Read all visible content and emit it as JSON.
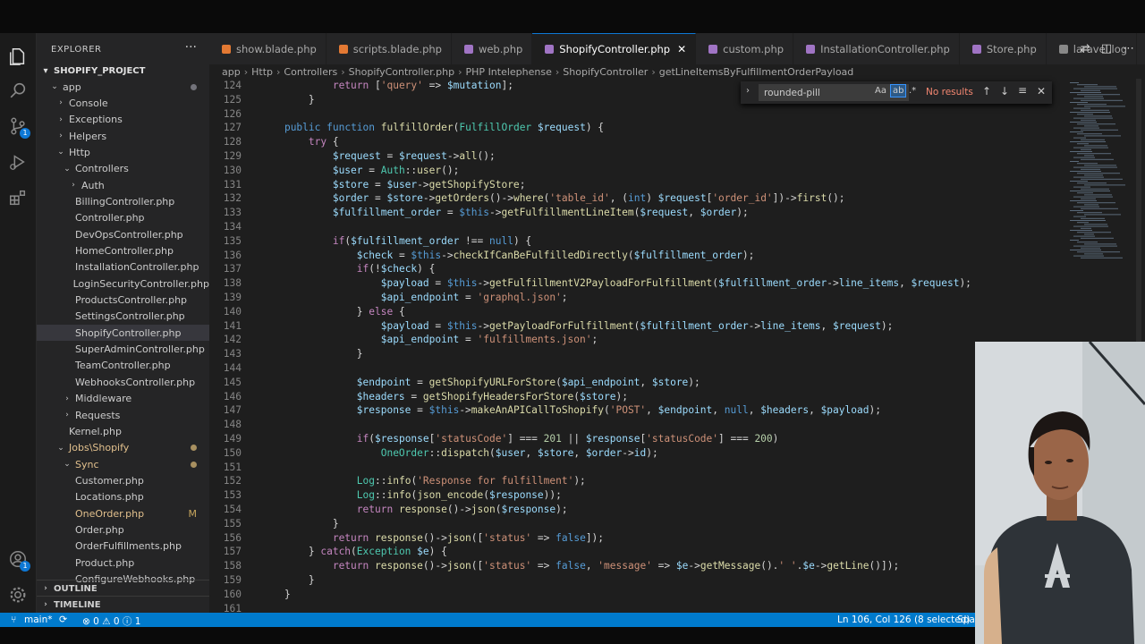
{
  "sidebar": {
    "title": "EXPLORER",
    "more": "···",
    "project": "SHOPIFY_PROJECT",
    "items": [
      {
        "label": "app",
        "depth": 0,
        "kind": "open",
        "dot": true
      },
      {
        "label": "Console",
        "depth": 1,
        "kind": "closed"
      },
      {
        "label": "Exceptions",
        "depth": 1,
        "kind": "closed"
      },
      {
        "label": "Helpers",
        "depth": 1,
        "kind": "closed"
      },
      {
        "label": "Http",
        "depth": 1,
        "kind": "open"
      },
      {
        "label": "Controllers",
        "depth": 2,
        "kind": "open"
      },
      {
        "label": "Auth",
        "depth": 3,
        "kind": "closed"
      },
      {
        "label": "BillingController.php",
        "depth": 3,
        "kind": "file"
      },
      {
        "label": "Controller.php",
        "depth": 3,
        "kind": "file"
      },
      {
        "label": "DevOpsController.php",
        "depth": 3,
        "kind": "file"
      },
      {
        "label": "HomeController.php",
        "depth": 3,
        "kind": "file"
      },
      {
        "label": "InstallationController.php",
        "depth": 3,
        "kind": "file"
      },
      {
        "label": "LoginSecurityController.php",
        "depth": 3,
        "kind": "file"
      },
      {
        "label": "ProductsController.php",
        "depth": 3,
        "kind": "file"
      },
      {
        "label": "SettingsController.php",
        "depth": 3,
        "kind": "file"
      },
      {
        "label": "ShopifyController.php",
        "depth": 3,
        "kind": "file",
        "selected": true
      },
      {
        "label": "SuperAdminController.php",
        "depth": 3,
        "kind": "file"
      },
      {
        "label": "TeamController.php",
        "depth": 3,
        "kind": "file"
      },
      {
        "label": "WebhooksController.php",
        "depth": 3,
        "kind": "file"
      },
      {
        "label": "Middleware",
        "depth": 2,
        "kind": "closed"
      },
      {
        "label": "Requests",
        "depth": 2,
        "kind": "closed"
      },
      {
        "label": "Kernel.php",
        "depth": 2,
        "kind": "file"
      },
      {
        "label": "Jobs\\Shopify",
        "depth": 1,
        "kind": "open",
        "dot": true,
        "color": "#e2c08d"
      },
      {
        "label": "Sync",
        "depth": 2,
        "kind": "open",
        "dot": true,
        "color": "#e2c08d"
      },
      {
        "label": "Customer.php",
        "depth": 3,
        "kind": "file"
      },
      {
        "label": "Locations.php",
        "depth": 3,
        "kind": "file"
      },
      {
        "label": "OneOrder.php",
        "depth": 3,
        "kind": "file",
        "color": "#e2c08d",
        "mod": "M"
      },
      {
        "label": "Order.php",
        "depth": 3,
        "kind": "file"
      },
      {
        "label": "OrderFulfillments.php",
        "depth": 3,
        "kind": "file"
      },
      {
        "label": "Product.php",
        "depth": 3,
        "kind": "file"
      },
      {
        "label": "ConfigureWebhooks.php",
        "depth": 3,
        "kind": "file"
      }
    ],
    "outline": "OUTLINE",
    "timeline": "TIMELINE"
  },
  "tabs": [
    {
      "label": "show.blade.php",
      "icon_color": "#e37933"
    },
    {
      "label": "scripts.blade.php",
      "icon_color": "#e37933"
    },
    {
      "label": "web.php",
      "icon_color": "#a074c4"
    },
    {
      "label": "ShopifyController.php",
      "icon_color": "#a074c4",
      "active": true,
      "close": "✕"
    },
    {
      "label": "custom.php",
      "icon_color": "#a074c4"
    },
    {
      "label": "InstallationController.php",
      "icon_color": "#a074c4"
    },
    {
      "label": "Store.php",
      "icon_color": "#a074c4"
    },
    {
      "label": "laravel.log",
      "icon_color": "#888888"
    }
  ],
  "breadcrumb": [
    "app",
    "Http",
    "Controllers",
    "ShopifyController.php",
    "PHP Intelephense",
    "ShopifyController",
    "getLineItemsByFulfillmentOrderPayload"
  ],
  "find": {
    "query": "rounded-pill",
    "case": "Aa",
    "word": "ab",
    "regex": ".*",
    "result": "No results"
  },
  "code_lines": [
    {
      "n": "124",
      "h": "            <span class=\"c\">return</span> [<span class=\"s\">'query'</span> => <span class=\"v\">$mutation</span>];"
    },
    {
      "n": "125",
      "h": "        }"
    },
    {
      "n": "126",
      "h": ""
    },
    {
      "n": "127",
      "h": "    <span class=\"k\">public</span> <span class=\"k\">function</span> <span class=\"f\">fulfillOrder</span>(<span class=\"t\">FulfillOrder</span> <span class=\"v\">$request</span>) {"
    },
    {
      "n": "128",
      "h": "        <span class=\"c\">try</span> {"
    },
    {
      "n": "129",
      "h": "            <span class=\"v\">$request</span> = <span class=\"v\">$request</span>-><span class=\"f\">all</span>();"
    },
    {
      "n": "130",
      "h": "            <span class=\"v\">$user</span> = <span class=\"t\">Auth</span>::<span class=\"f\">user</span>();"
    },
    {
      "n": "131",
      "h": "            <span class=\"v\">$store</span> = <span class=\"v\">$user</span>-><span class=\"f\">getShopifyStore</span>;"
    },
    {
      "n": "132",
      "h": "            <span class=\"v\">$order</span> = <span class=\"v\">$store</span>-><span class=\"f\">getOrders</span>()-><span class=\"f\">where</span>(<span class=\"s\">'table_id'</span>, (<span class=\"k\">int</span>) <span class=\"v\">$request</span>[<span class=\"s\">'order_id'</span>])-><span class=\"f\">first</span>();"
    },
    {
      "n": "133",
      "h": "            <span class=\"v\">$fulfillment_order</span> = <span class=\"k\">$this</span>-><span class=\"f\">getFulfillmentLineItem</span>(<span class=\"v\">$request</span>, <span class=\"v\">$order</span>);"
    },
    {
      "n": "134",
      "h": ""
    },
    {
      "n": "135",
      "h": "            <span class=\"c\">if</span>(<span class=\"v\">$fulfillment_order</span> !== <span class=\"k\">null</span>) {"
    },
    {
      "n": "136",
      "h": "                <span class=\"v\">$check</span> = <span class=\"k\">$this</span>-><span class=\"f\">checkIfCanBeFulfilledDirectly</span>(<span class=\"v\">$fulfillment_order</span>);"
    },
    {
      "n": "137",
      "h": "                <span class=\"c\">if</span>(!<span class=\"v\">$check</span>) {"
    },
    {
      "n": "138",
      "h": "                    <span class=\"v\">$payload</span> = <span class=\"k\">$this</span>-><span class=\"f\">getFulfillmentV2PayloadForFulfillment</span>(<span class=\"v\">$fulfillment_order</span>-><span class=\"v\">line_items</span>, <span class=\"v\">$request</span>);"
    },
    {
      "n": "139",
      "h": "                    <span class=\"v\">$api_endpoint</span> = <span class=\"s\">'graphql.json'</span>;"
    },
    {
      "n": "140",
      "h": "                } <span class=\"c\">else</span> {"
    },
    {
      "n": "141",
      "h": "                    <span class=\"v\">$payload</span> = <span class=\"k\">$this</span>-><span class=\"f\">getPayloadForFulfillment</span>(<span class=\"v\">$fulfillment_order</span>-><span class=\"v\">line_items</span>, <span class=\"v\">$request</span>);"
    },
    {
      "n": "142",
      "h": "                    <span class=\"v\">$api_endpoint</span> = <span class=\"s\">'fulfillments.json'</span>;"
    },
    {
      "n": "143",
      "h": "                }"
    },
    {
      "n": "144",
      "h": ""
    },
    {
      "n": "145",
      "h": "                <span class=\"v\">$endpoint</span> = <span class=\"f\">getShopifyURLForStore</span>(<span class=\"v\">$api_endpoint</span>, <span class=\"v\">$store</span>);"
    },
    {
      "n": "146",
      "h": "                <span class=\"v\">$headers</span> = <span class=\"f\">getShopifyHeadersForStore</span>(<span class=\"v\">$store</span>);"
    },
    {
      "n": "147",
      "h": "                <span class=\"v\">$response</span> = <span class=\"k\">$this</span>-><span class=\"f\">makeAnAPICallToShopify</span>(<span class=\"s\">'POST'</span>, <span class=\"v\">$endpoint</span>, <span class=\"k\">null</span>, <span class=\"v\">$headers</span>, <span class=\"v\">$payload</span>);"
    },
    {
      "n": "148",
      "h": ""
    },
    {
      "n": "149",
      "h": "                <span class=\"c\">if</span>(<span class=\"v\">$response</span>[<span class=\"s\">'statusCode'</span>] === <span class=\"n\">201</span> || <span class=\"v\">$response</span>[<span class=\"s\">'statusCode'</span>] === <span class=\"n\">200</span>)"
    },
    {
      "n": "150",
      "h": "                    <span class=\"t\">OneOrder</span>::<span class=\"f\">dispatch</span>(<span class=\"v\">$user</span>, <span class=\"v\">$store</span>, <span class=\"v\">$order</span>-><span class=\"v\">id</span>);"
    },
    {
      "n": "151",
      "h": ""
    },
    {
      "n": "152",
      "h": "                <span class=\"t\">Log</span>::<span class=\"f\">info</span>(<span class=\"s\">'Response for fulfillment'</span>);"
    },
    {
      "n": "153",
      "h": "                <span class=\"t\">Log</span>::<span class=\"f\">info</span>(<span class=\"f\">json_encode</span>(<span class=\"v\">$response</span>));"
    },
    {
      "n": "154",
      "h": "                <span class=\"c\">return</span> <span class=\"f\">response</span>()-><span class=\"f\">json</span>(<span class=\"v\">$response</span>);"
    },
    {
      "n": "155",
      "h": "            }"
    },
    {
      "n": "156",
      "h": "            <span class=\"c\">return</span> <span class=\"f\">response</span>()-><span class=\"f\">json</span>([<span class=\"s\">'status'</span> => <span class=\"k\">false</span>]);"
    },
    {
      "n": "157",
      "h": "        } <span class=\"c\">catch</span>(<span class=\"t\">Exception</span> <span class=\"v\">$e</span>) {"
    },
    {
      "n": "158",
      "h": "            <span class=\"c\">return</span> <span class=\"f\">response</span>()-><span class=\"f\">json</span>([<span class=\"s\">'status'</span> => <span class=\"k\">false</span>, <span class=\"s\">'message'</span> => <span class=\"v\">$e</span>-><span class=\"f\">getMessage</span>().<span class=\"s\">' '</span>.<span class=\"v\">$e</span>-><span class=\"f\">getLine</span>()]);"
    },
    {
      "n": "159",
      "h": "        }"
    },
    {
      "n": "160",
      "h": "    }"
    },
    {
      "n": "161",
      "h": ""
    }
  ],
  "status": {
    "branch": "main*",
    "problems": "⊗ 0 ⚠ 0 ⓘ 1",
    "position": "Ln 106, Col 126 (8 selected)",
    "spaces": "Spac"
  },
  "activity_badges": {
    "source_control": "1",
    "account": "1"
  }
}
